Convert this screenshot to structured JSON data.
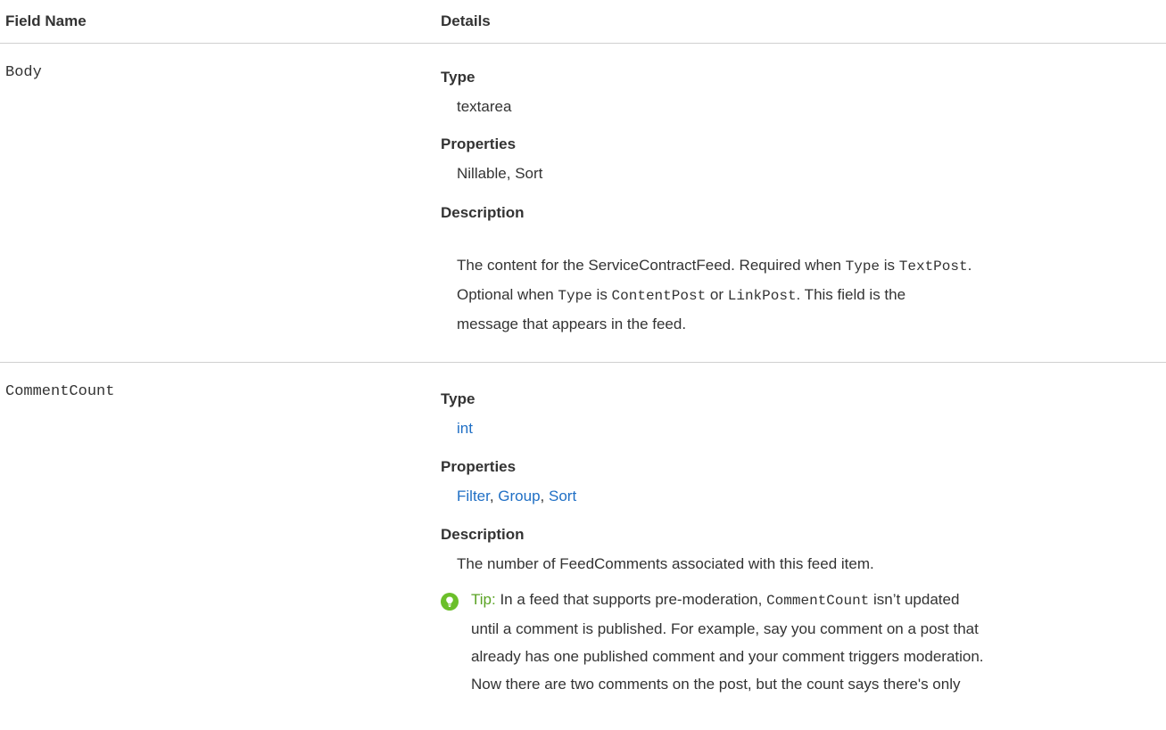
{
  "header": {
    "field_name": "Field Name",
    "details": "Details"
  },
  "rows": [
    {
      "name": "Body",
      "type_label": "Type",
      "type_value": "textarea",
      "properties_label": "Properties",
      "properties_value": "Nillable, Sort",
      "description_label": "Description",
      "description": {
        "p1": "The content for the ServiceContractFeed. Required when ",
        "c1": "Type",
        "p2": " is ",
        "c2": "TextPost",
        "p3": ".",
        "p4": "Optional when ",
        "c3": "Type",
        "p5": " is ",
        "c4": "ContentPost",
        "p6": " or ",
        "c5": "LinkPost",
        "p7": ". This field is the",
        "p8": "message that appears in the feed."
      }
    },
    {
      "name": "CommentCount",
      "type_label": "Type",
      "type_value": "int",
      "properties_label": "Properties",
      "properties_links": [
        "Filter",
        "Group",
        "Sort"
      ],
      "properties_sep": ", ",
      "description_label": "Description",
      "description": "The number of FeedComments associated with this feed item.",
      "tip": {
        "label": "Tip:",
        "l1a": " In a feed that supports pre-moderation, ",
        "l1code": "CommentCount",
        "l1b": " isn’t updated",
        "l2": "until a comment is published. For example, say you comment on a post that",
        "l3": "already has one published comment and your comment triggers moderation.",
        "l4": "Now there are two comments on the post, but the count says there's only"
      }
    }
  ],
  "icons": {
    "tip": "lightbulb-icon"
  },
  "colors": {
    "link": "#1f6fc5",
    "tip_icon": "#6bbf2a",
    "tip_label": "#5aa324",
    "divider": "#d0d0d0"
  }
}
